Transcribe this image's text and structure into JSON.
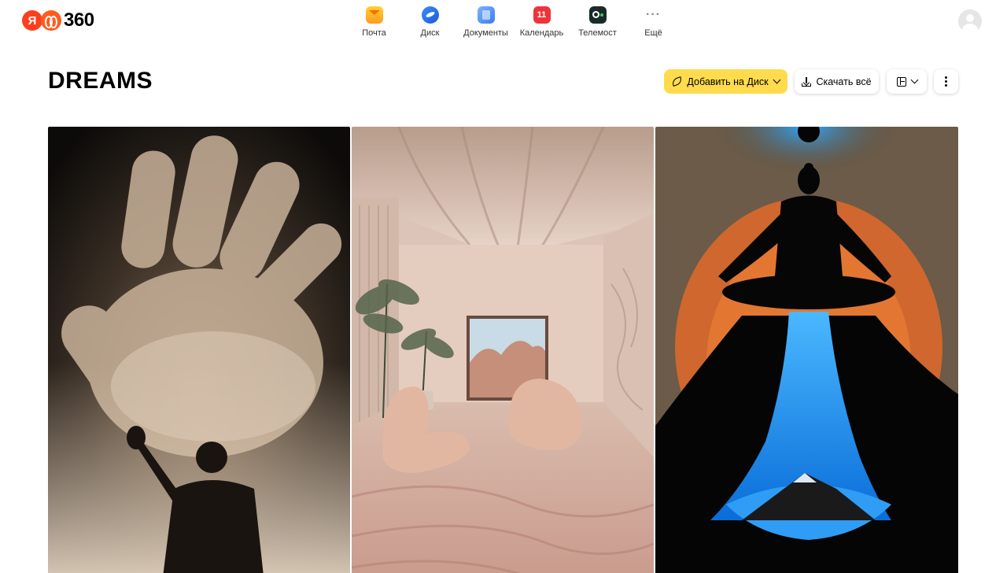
{
  "header": {
    "logo": {
      "ya": "Я",
      "text": "360"
    },
    "services": [
      {
        "label": "Почта",
        "icon": "mail-icon"
      },
      {
        "label": "Диск",
        "icon": "disk-icon"
      },
      {
        "label": "Документы",
        "icon": "docs-icon"
      },
      {
        "label": "Календарь",
        "icon": "calendar-icon",
        "badge": "11"
      },
      {
        "label": "Телемост",
        "icon": "telemost-icon"
      },
      {
        "label": "Ещё",
        "icon": "more-icon"
      }
    ],
    "avatar": "user-avatar-icon"
  },
  "page": {
    "title": "DREAMS"
  },
  "actions": {
    "add_to_disk": "Добавить на Диск",
    "download_all": "Скачать всё"
  },
  "colors": {
    "accent_yellow": "#ffdb4d",
    "brand_red": "#fc3f1d"
  },
  "gallery": {
    "photos": [
      {
        "name": "hand-silhouette-photo"
      },
      {
        "name": "pink-room-photo"
      },
      {
        "name": "meditation-silhouette-photo"
      }
    ]
  }
}
